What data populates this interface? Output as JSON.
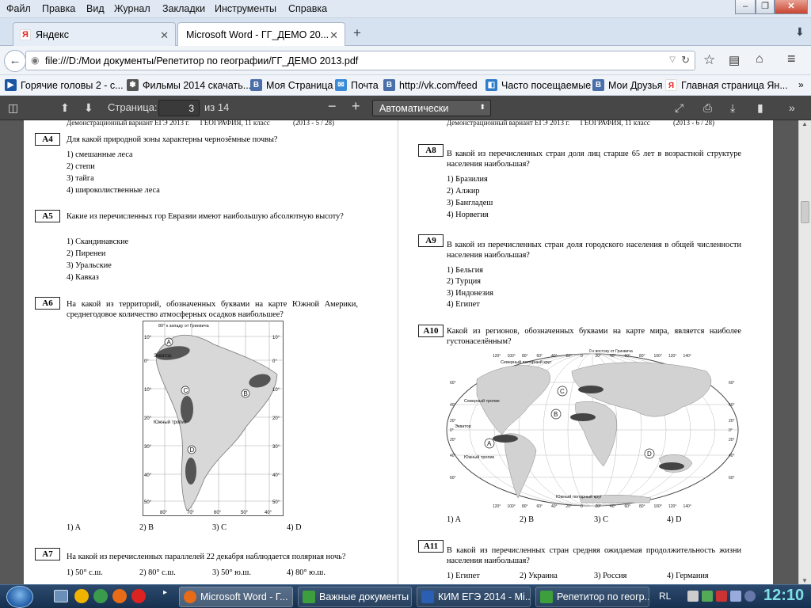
{
  "menu": [
    "Файл",
    "Правка",
    "Вид",
    "Журнал",
    "Закладки",
    "Инструменты",
    "Справка"
  ],
  "tabs": [
    {
      "label": "Яндекс",
      "active": false
    },
    {
      "label": "Microsoft Word - ГГ_ДЕМО 20...",
      "active": true
    }
  ],
  "url": "file:///D:/Мои документы/Репетитор по географии/ГГ_ДЕМО 2013.pdf",
  "bookmarks": [
    "Горячие головы 2 - с...",
    "Фильмы 2014 скачать...",
    "Моя Страница",
    "Почта",
    "http://vk.com/feed",
    "Часто посещаемые",
    "Мои Друзья",
    "Главная страница Ян..."
  ],
  "pdf_toolbar": {
    "page_label": "Страница:",
    "page_value": "3",
    "page_total": "из 14",
    "zoom": "Автоматически"
  },
  "doc": {
    "header_left": "Демонстрационный вариант ЕГЭ 2013 г.      ГЕОГРАФИЯ, 11 класс             (2013 - 5 / 28)",
    "header_right": "Демонстрационный вариант ЕГЭ 2013 г.      ГЕОГРАФИЯ, 11 класс             (2013 - 6 / 28)",
    "questions": [
      {
        "id": "A4",
        "text": "Для какой природной зоны характерны чернозёмные почвы?",
        "options": [
          "1)  смешанные леса",
          "2)  степи",
          "3)  тайга",
          "4)  широколиственные леса"
        ]
      },
      {
        "id": "A5",
        "text": "Какие из перечисленных гор Евразии имеют наибольшую абсолютную высоту?",
        "options": [
          "1)  Скандинавские",
          "2)  Пиренеи",
          "3)  Уральские",
          "4)  Кавказ"
        ]
      },
      {
        "id": "A6",
        "text": "На какой из территорий, обозначенных буквами на карте Южной Америки, среднегодовое количество атмосферных осадков наибольшее?",
        "options": [
          "1)  A",
          "2)  B",
          "3)  C",
          "4)  D"
        ]
      },
      {
        "id": "A7",
        "text": "На какой из перечисленных параллелей 22 декабря наблюдается полярная ночь?",
        "options": [
          "1)  50° с.ш.",
          "2)  80° с.ш.",
          "3)  50° ю.ш.",
          "4)  80° ю.ш."
        ]
      },
      {
        "id": "A8",
        "text": "В какой из перечисленных стран доля лиц старше 65 лет в возрастной структуре населения наибольшая?",
        "options": [
          "1)  Бразилия",
          "2)  Алжир",
          "3)  Бангладеш",
          "4)  Норвегия"
        ]
      },
      {
        "id": "A9",
        "text": "В какой из перечисленных стран доля городского населения в общей численности населения наибольшая?",
        "options": [
          "1)  Бельгия",
          "2)  Турция",
          "3)  Индонезия",
          "4)  Египет"
        ]
      },
      {
        "id": "A10",
        "text": "Какой из регионов, обозначенных буквами на карте мира, является наиболее густонаселённым?",
        "options": [
          "1)  A",
          "2)  B",
          "3)  C",
          "4)  D"
        ]
      },
      {
        "id": "A11",
        "text": "В какой из перечисленных стран средняя ожидаемая продолжительность жизни населения наибольшая?",
        "options": [
          "1)  Египет",
          "2)  Украина",
          "3)  Россия",
          "4)  Германия"
        ]
      }
    ],
    "sa_map": {
      "letters": [
        "A",
        "B",
        "C",
        "D"
      ],
      "lat_left": [
        "10°",
        "0°",
        "10°",
        "20°",
        "30°",
        "40°",
        "50°"
      ],
      "lat_right": [
        "10°",
        "0°",
        "10°",
        "20°",
        "30°",
        "40°",
        "50°"
      ],
      "lon_bottom": [
        "80°",
        "70°",
        "60°",
        "50°",
        "40°"
      ],
      "labels": [
        "Экватор",
        "Южный тропик",
        "80° к западу от Гринвича"
      ]
    },
    "world_map": {
      "letters": [
        "A",
        "B",
        "C",
        "D"
      ],
      "labels": [
        "Экватор",
        "Северный тропик",
        "Южный тропик",
        "Северный полярный круг",
        "Южный полярный круг",
        "0 к востоку от Гринвича"
      ],
      "lon_top": [
        "120°",
        "100°",
        "80°",
        "60°",
        "40°",
        "20°",
        "0",
        "20°",
        "40°",
        "60°",
        "80°",
        "100°",
        "120°",
        "140°"
      ],
      "lat": [
        "60°",
        "40°",
        "20°",
        "0°",
        "20°",
        "40°",
        "60°"
      ]
    }
  },
  "taskbar": [
    "Microsoft Word - Г...",
    "Важные документы",
    "КИМ ЕГЭ 2014 - Mi...",
    "Репетитор по геогр..."
  ],
  "tray": {
    "lang": "RL",
    "time": "12:10"
  }
}
